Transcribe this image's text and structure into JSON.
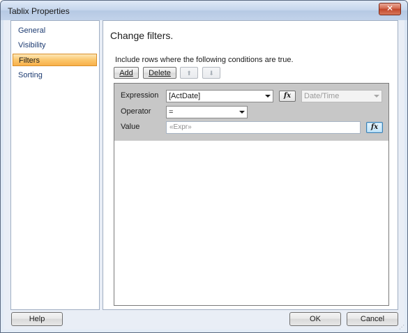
{
  "window": {
    "title": "Tablix Properties",
    "close_label": "✕"
  },
  "nav": {
    "items": [
      {
        "label": "General"
      },
      {
        "label": "Visibility"
      },
      {
        "label": "Filters",
        "selected": true
      },
      {
        "label": "Sorting"
      }
    ]
  },
  "panel": {
    "heading": "Change filters.",
    "instruction": "Include rows where the following conditions are true.",
    "toolbar": {
      "add_label": "Add",
      "delete_label": "Delete",
      "move_up_icon": "arrow-up-icon",
      "move_down_icon": "arrow-down-icon"
    },
    "filter": {
      "expression_label": "Expression",
      "expression_value": "[ActDate]",
      "type_value": "Date/Time",
      "operator_label": "Operator",
      "operator_value": "=",
      "value_label": "Value",
      "value_placeholder": "«Expr»",
      "fx_label": "fx"
    }
  },
  "footer": {
    "help_label": "Help",
    "ok_label": "OK",
    "cancel_label": "Cancel"
  },
  "colors": {
    "selected_nav": "#f8b04a",
    "filter_row_bg": "#c7c7c7",
    "title_bar": "#c4d5ec"
  }
}
